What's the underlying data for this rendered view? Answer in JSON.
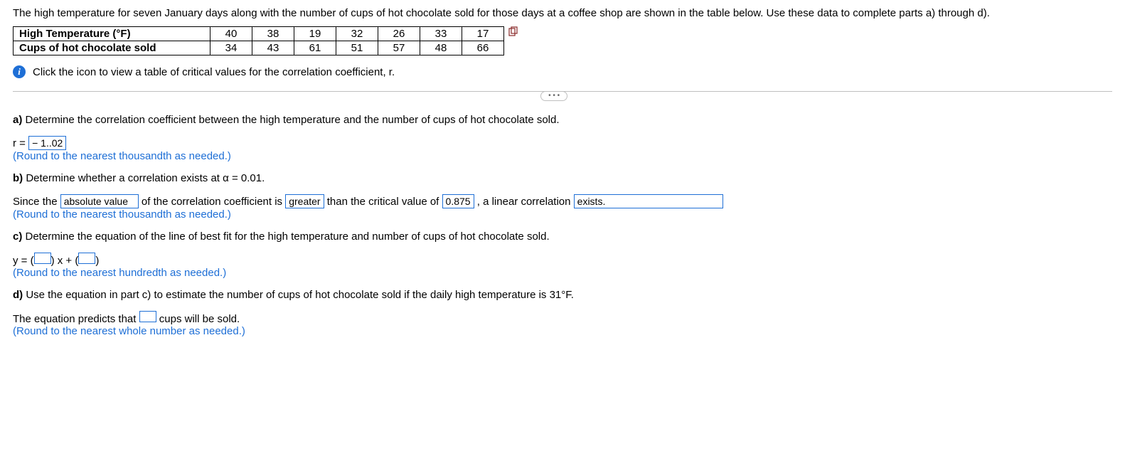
{
  "intro": "The high temperature for seven January days along with the number of cups of hot chocolate sold for those days at a coffee shop are shown in the table below. Use these data to complete parts a) through d).",
  "table": {
    "row1_label": "High Temperature (°F)",
    "row1": [
      "40",
      "38",
      "19",
      "32",
      "26",
      "33",
      "17"
    ],
    "row2_label": "Cups of hot chocolate sold",
    "row2": [
      "34",
      "43",
      "61",
      "51",
      "57",
      "48",
      "66"
    ]
  },
  "info_line": "Click the icon to view a table of critical values for the correlation coefficient, r.",
  "a": {
    "label": "a)",
    "prompt": " Determine the correlation coefficient between the high temperature and the number of cups of hot chocolate sold.",
    "r_prefix": "r = ",
    "r_value": "− 1..02",
    "round_note": "(Round to the nearest thousandth as needed.)"
  },
  "b": {
    "label": "b)",
    "prompt": " Determine whether a correlation exists at α = 0.01.",
    "t1": "Since the ",
    "sel1": "absolute value",
    "t2": " of the correlation coefficient is ",
    "sel2": "greater",
    "t3": " than the critical value of ",
    "crit": "0.875",
    "t4": ", a linear correlation ",
    "sel3": "exists.",
    "round_note": "(Round to the nearest thousandth as needed.)"
  },
  "c": {
    "label": "c)",
    "prompt": " Determine the equation of the line of best fit for the high temperature and number of cups of hot chocolate sold.",
    "eq_prefix": "y = (",
    "mid": ") x + (",
    "suffix": ")",
    "round_note": "(Round to the nearest hundredth as needed.)"
  },
  "d": {
    "label": "d)",
    "prompt": " Use the equation in part c) to estimate the number of cups of hot chocolate sold if the daily high temperature is 31°F.",
    "sentence_1": "The equation predicts that ",
    "sentence_2": " cups will be sold.",
    "round_note": "(Round to the nearest whole number as needed.)"
  }
}
